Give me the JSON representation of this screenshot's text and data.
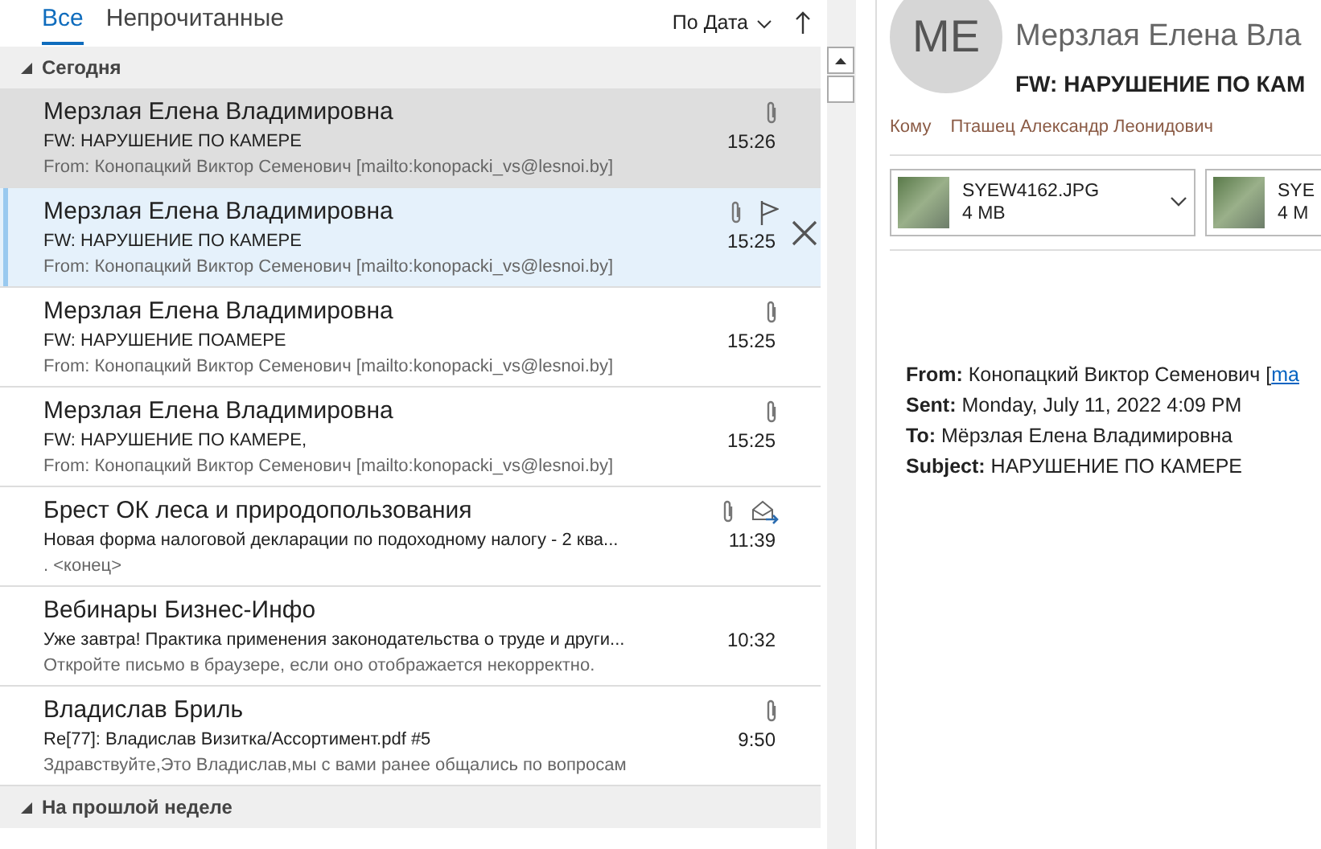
{
  "tabs": [
    {
      "label": "Все",
      "selected": true
    },
    {
      "label": "Непрочитанные",
      "selected": false
    }
  ],
  "sort": {
    "label": "По Дата"
  },
  "groups": [
    {
      "label": "Сегодня",
      "expanded": true,
      "messages": [
        {
          "sender": "Мерзлая Елена Владимировна",
          "subject": "FW: НАРУШЕНИЕ ПО КАМЕРЕ",
          "preview": "From: Конопацкий Виктор Семенович [mailto:konopacki_vs@lesnoi.by]",
          "time": "15:26",
          "attachment": true,
          "forwarded": false,
          "selected": true,
          "hovered": false
        },
        {
          "sender": "Мерзлая Елена Владимировна",
          "subject": "FW: НАРУШЕНИЕ ПО КАМЕРЕ",
          "preview": "From: Конопацкий Виктор Семенович [mailto:konopacki_vs@lesnoi.by]",
          "time": "15:25",
          "attachment": true,
          "forwarded": false,
          "selected": false,
          "hovered": true
        },
        {
          "sender": "Мерзлая Елена Владимировна",
          "subject": "FW: НАРУШЕНИЕ ПОАМЕРЕ",
          "preview": "From: Конопацкий Виктор Семенович [mailto:konopacki_vs@lesnoi.by]",
          "time": "15:25",
          "attachment": true,
          "forwarded": false,
          "selected": false,
          "hovered": false
        },
        {
          "sender": "Мерзлая Елена Владимировна",
          "subject": "FW: НАРУШЕНИЕ ПО КАМЕРЕ,",
          "preview": "From: Конопацкий Виктор Семенович [mailto:konopacki_vs@lesnoi.by]",
          "time": "15:25",
          "attachment": true,
          "forwarded": false,
          "selected": false,
          "hovered": false
        },
        {
          "sender": "Брест ОК леса  и природопользования",
          "subject": "Новая форма налоговой декларации по подоходному налогу - 2 ква...",
          "preview": ". <конец>",
          "time": "11:39",
          "attachment": true,
          "forwarded": true,
          "selected": false,
          "hovered": false
        },
        {
          "sender": "Вебинары Бизнес-Инфо",
          "subject": "Уже завтра! Практика применения законодательства о труде и други...",
          "preview": "Откройте письмо в браузере, если оно отображается некорректно.",
          "time": "10:32",
          "attachment": false,
          "forwarded": false,
          "selected": false,
          "hovered": false
        },
        {
          "sender": "Владислав Бриль",
          "subject": "Re[77]: Владислав Визитка/Ассортимент.pdf #5",
          "preview": "Здравствуйте,Это Владислав,мы с вами ранее общались по вопросам",
          "time": "9:50",
          "attachment": true,
          "forwarded": false,
          "selected": false,
          "hovered": false
        }
      ]
    },
    {
      "label": "На прошлой неделе",
      "expanded": true
    }
  ],
  "reading_pane": {
    "avatar_initials": "ME",
    "sender": "Мерзлая Елена Вла",
    "subject": "FW: НАРУШЕНИЕ ПО КАМ",
    "to_label": "Кому",
    "to": "Пташец Александр Леонидович",
    "attachments": [
      {
        "name": "SYEW4162.JPG",
        "size": "4 MB"
      },
      {
        "name": "SYE",
        "size": "4 M"
      }
    ],
    "body": [
      {
        "label": "From:",
        "value": "Конопацкий Виктор Семенович [",
        "link": "ma"
      },
      {
        "label": "Sent:",
        "value": "Monday, July 11, 2022 4:09 PM"
      },
      {
        "label": "To:",
        "value": "Мёрзлая Елена Владимировна"
      },
      {
        "label": "Subject:",
        "value": "НАРУШЕНИЕ ПО КАМЕРЕ"
      }
    ]
  }
}
